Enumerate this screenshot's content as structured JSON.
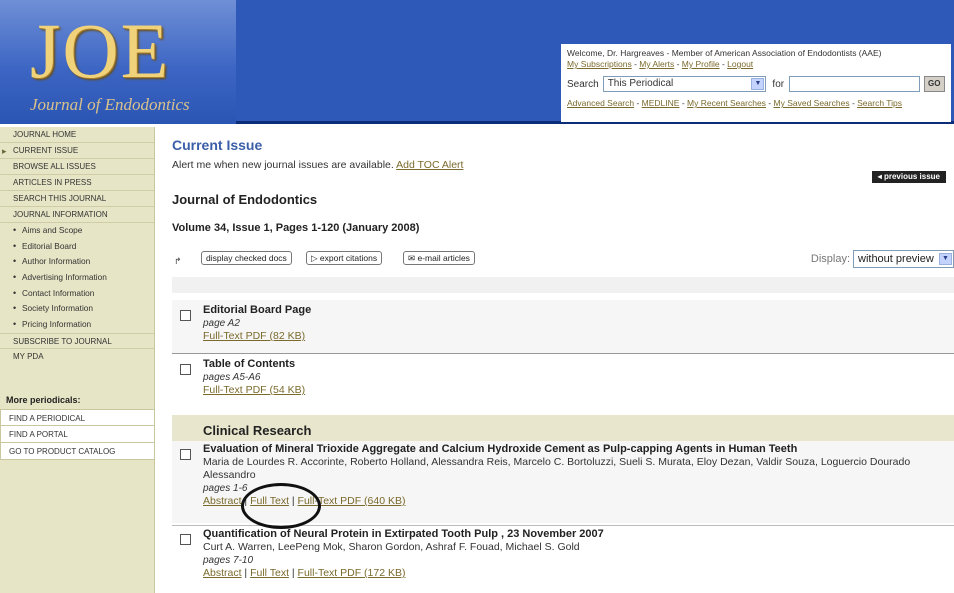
{
  "header": {
    "logo_text": "JOE",
    "logo_subtitle": "Journal of Endodontics",
    "welcome": "Welcome, Dr. Hargreaves - Member of American Association of Endodontists (AAE)",
    "user_links": [
      "My Subscriptions",
      "My Alerts",
      "My Profile",
      "Logout"
    ],
    "search_label": "Search",
    "search_scope": "This Periodical",
    "for_label": "for",
    "for_value": "",
    "go_label": "GO",
    "search_links": [
      "Advanced Search",
      "MEDLINE",
      "My Recent Searches",
      "My Saved Searches",
      "Search Tips"
    ]
  },
  "sidebar": {
    "items": [
      {
        "label": "JOURNAL HOME"
      },
      {
        "label": "CURRENT ISSUE"
      },
      {
        "label": "BROWSE ALL ISSUES"
      },
      {
        "label": "ARTICLES IN PRESS"
      },
      {
        "label": "SEARCH THIS JOURNAL"
      },
      {
        "label": "JOURNAL INFORMATION"
      }
    ],
    "sub_items": [
      {
        "label": "Aims and Scope"
      },
      {
        "label": "Editorial Board"
      },
      {
        "label": "Author Information"
      },
      {
        "label": "Advertising Information"
      },
      {
        "label": "Contact Information"
      },
      {
        "label": "Society Information"
      },
      {
        "label": "Pricing Information"
      }
    ],
    "items_after": [
      {
        "label": "SUBSCRIBE TO JOURNAL"
      },
      {
        "label": "MY PDA"
      }
    ],
    "more_title": "More periodicals:",
    "more_items": [
      {
        "label": "FIND A PERIODICAL"
      },
      {
        "label": "FIND A PORTAL"
      },
      {
        "label": "GO TO PRODUCT CATALOG"
      }
    ]
  },
  "main": {
    "title": "Current Issue",
    "alert_text": "Alert me when new journal issues are available.",
    "alert_link": "Add TOC Alert",
    "prev_issue": "◂ previous issue",
    "journal_title": "Journal of Endodontics",
    "volume": "Volume 34, Issue 1, Pages 1-120 (January 2008)",
    "toolbar": {
      "display_checked": "display checked docs",
      "export": "export citations",
      "email": "e-mail articles",
      "display_label": "Display:",
      "display_value": "without preview"
    },
    "section_title": "Clinical Research",
    "articles": [
      {
        "title": "Editorial Board Page",
        "pages": "page A2",
        "links": [
          "Full-Text PDF (82 KB)"
        ]
      },
      {
        "title": "Table of Contents",
        "pages": "pages A5-A6",
        "links": [
          "Full-Text PDF (54 KB)"
        ]
      },
      {
        "title": "Evaluation of Mineral Trioxide Aggregate and Calcium Hydroxide Cement as Pulp-capping Agents in Human Teeth",
        "authors": "Maria de Lourdes R. Accorinte, Roberto Holland, Alessandra Reis, Marcelo C. Bortoluzzi, Sueli S. Murata, Eloy Dezan, Valdir Souza, Loguercio Dourado Alessandro",
        "pages": "pages 1-6",
        "links": [
          "Abstract",
          "Full Text",
          "Full-Text PDF (640 KB)"
        ]
      },
      {
        "title": "Quantification of Neural Protein in Extirpated Tooth Pulp , 23 November 2007",
        "authors": "Curt A. Warren, LeePeng Mok, Sharon Gordon, Ashraf F. Fouad, Michael S. Gold",
        "pages": "pages 7-10",
        "links": [
          "Abstract",
          "Full Text",
          "Full-Text PDF (172 KB)"
        ]
      }
    ]
  }
}
